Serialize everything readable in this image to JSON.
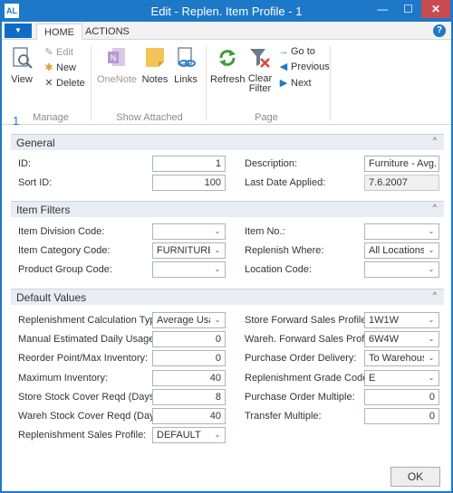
{
  "window": {
    "title": "Edit - Replen. Item Profile - 1",
    "app_icon_text": "AL",
    "min_glyph": "—",
    "max_glyph": "☐",
    "close_glyph": "✕"
  },
  "tabs": {
    "menu_glyph": "▼",
    "home": "HOME",
    "actions": "ACTIONS",
    "help_glyph": "?"
  },
  "ribbon": {
    "manage": {
      "label": "Manage",
      "view": "View",
      "edit": "Edit",
      "new": "New",
      "delete": "Delete"
    },
    "show_attached": {
      "label": "Show Attached",
      "onenote": "OneNote",
      "notes": "Notes",
      "links": "Links"
    },
    "page": {
      "label": "Page",
      "refresh": "Refresh",
      "clear_filter_1": "Clear",
      "clear_filter_2": "Filter",
      "go_to": "Go to",
      "previous": "Previous",
      "next": "Next"
    }
  },
  "record_id": "1",
  "general": {
    "title": "General",
    "id_label": "ID:",
    "id_value": "1",
    "sort_id_label": "Sort ID:",
    "sort_id_value": "100",
    "description_label": "Description:",
    "description_value": "Furniture - Avg. ...",
    "last_date_label": "Last Date Applied:",
    "last_date_value": "7.6.2007"
  },
  "item_filters": {
    "title": "Item Filters",
    "division_label": "Item Division Code:",
    "division_value": "",
    "category_label": "Item Category Code:",
    "category_value": "FURNITURE",
    "product_group_label": "Product Group Code:",
    "product_group_value": "",
    "item_no_label": "Item No.:",
    "item_no_value": "",
    "replenish_where_label": "Replenish Where:",
    "replenish_where_value": "All Locations",
    "location_label": "Location Code:",
    "location_value": ""
  },
  "defaults": {
    "title": "Default Values",
    "calc_type_label": "Replenishment Calculation Type:",
    "calc_type_value": "Average Usage",
    "manual_usage_label": "Manual Estimated Daily Usage:",
    "manual_usage_value": "0",
    "reorder_label": "Reorder Point/Max Inventory:",
    "reorder_value": "0",
    "max_inv_label": "Maximum Inventory:",
    "max_inv_value": "40",
    "store_cover_label": "Store Stock Cover Reqd (Days):",
    "store_cover_value": "8",
    "wareh_cover_label": "Wareh Stock Cover Reqd (Days):",
    "wareh_cover_value": "40",
    "sales_profile_label": "Replenishment Sales Profile:",
    "sales_profile_value": "DEFAULT",
    "store_fwd_label": "Store Forward Sales Profile:",
    "store_fwd_value": "1W1W",
    "wareh_fwd_label": "Wareh. Forward Sales Profile:",
    "wareh_fwd_value": "6W4W",
    "po_delivery_label": "Purchase Order Delivery:",
    "po_delivery_value": "To Warehouse",
    "grade_label": "Replenishment Grade Code:",
    "grade_value": "E",
    "po_multiple_label": "Purchase Order Multiple:",
    "po_multiple_value": "0",
    "transfer_multiple_label": "Transfer Multiple:",
    "transfer_multiple_value": "0"
  },
  "buttons": {
    "ok": "OK"
  },
  "glyphs": {
    "dropdown": "⌄",
    "collapse": "^"
  },
  "colors": {
    "accent": "#1e78c8",
    "close": "#c74b50",
    "section_bg": "#e8edf3"
  }
}
